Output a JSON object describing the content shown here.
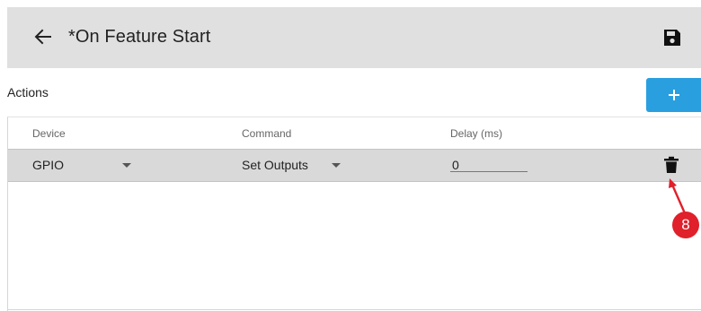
{
  "header": {
    "title": "*On Feature Start",
    "back_icon": "arrow-left-icon",
    "save_icon": "floppy-disk-icon"
  },
  "actions": {
    "label": "Actions",
    "add_icon": "plus-icon",
    "add_color": "#2a9fe0",
    "columns": [
      "Device",
      "Command",
      "Delay (ms)"
    ],
    "rows": [
      {
        "device": "GPIO",
        "command": "Set Outputs",
        "delay": "0",
        "delete_icon": "trash-icon"
      }
    ]
  },
  "annotation": {
    "callout_number": "8",
    "callout_color": "#e0202a"
  }
}
